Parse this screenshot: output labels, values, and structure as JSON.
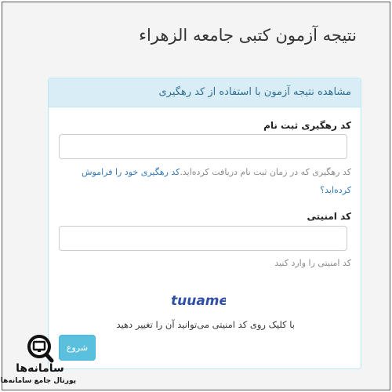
{
  "page": {
    "title": "نتیجه آزمون کتبی جامعه الزهراء"
  },
  "panel": {
    "heading": "مشاهده نتیجه آزمون با استفاده از کد رهگیری"
  },
  "tracking": {
    "label": "کد رهگیری ثبت نام",
    "value": "",
    "help_text": "کد رهگیری که در زمان ثبت نام دریافت کرده‌اید.",
    "forgot_link": "کد رهگیری خود را فراموش کرده‌اید؟"
  },
  "security": {
    "label": "کد امنیتی",
    "value": "",
    "help_text": "کد امنیتی را وارد کنید",
    "captcha_text": "tuuamei",
    "captcha_hint": "با کلیک روی کد امنیتی می‌توانید آن را تغییر دهید"
  },
  "actions": {
    "submit_label": "شروع"
  },
  "watermark": {
    "name": "سامانه‌ها",
    "tagline": "پورتال جامع سامانه‌ها",
    "icon": "search-monitor-icon"
  },
  "colors": {
    "panel_heading_bg": "#d9edf7",
    "panel_heading_text": "#31708f",
    "button_bg": "#5bc0de",
    "link": "#337ab7",
    "captcha": "#2f4fa8"
  }
}
